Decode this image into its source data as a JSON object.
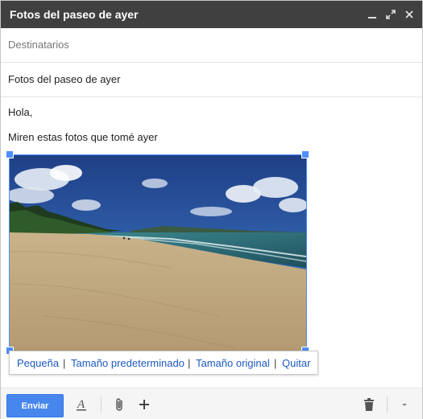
{
  "window": {
    "title": "Fotos del paseo de ayer",
    "controls": [
      "minimize-icon",
      "expand-icon",
      "close-icon"
    ]
  },
  "recipients": {
    "placeholder": "Destinatarios"
  },
  "subject": {
    "value": "Fotos del paseo de ayer"
  },
  "body": {
    "greeting": "Hola,",
    "line": "Miren estas fotos que tomé ayer"
  },
  "image_menu": {
    "small": "Pequeña",
    "default_size": "Tamaño predeterminado",
    "original_size": "Tamaño original",
    "remove": "Quitar",
    "separator": "|"
  },
  "toolbar": {
    "send_label": "Enviar",
    "icons": [
      "formatting-icon",
      "attach-icon",
      "more-insert-icon",
      "trash-icon",
      "more-options-icon"
    ]
  },
  "colors": {
    "accent": "#4d90fe",
    "send": "#4787ed",
    "titlebar": "#404040",
    "link": "#1c59c1"
  }
}
